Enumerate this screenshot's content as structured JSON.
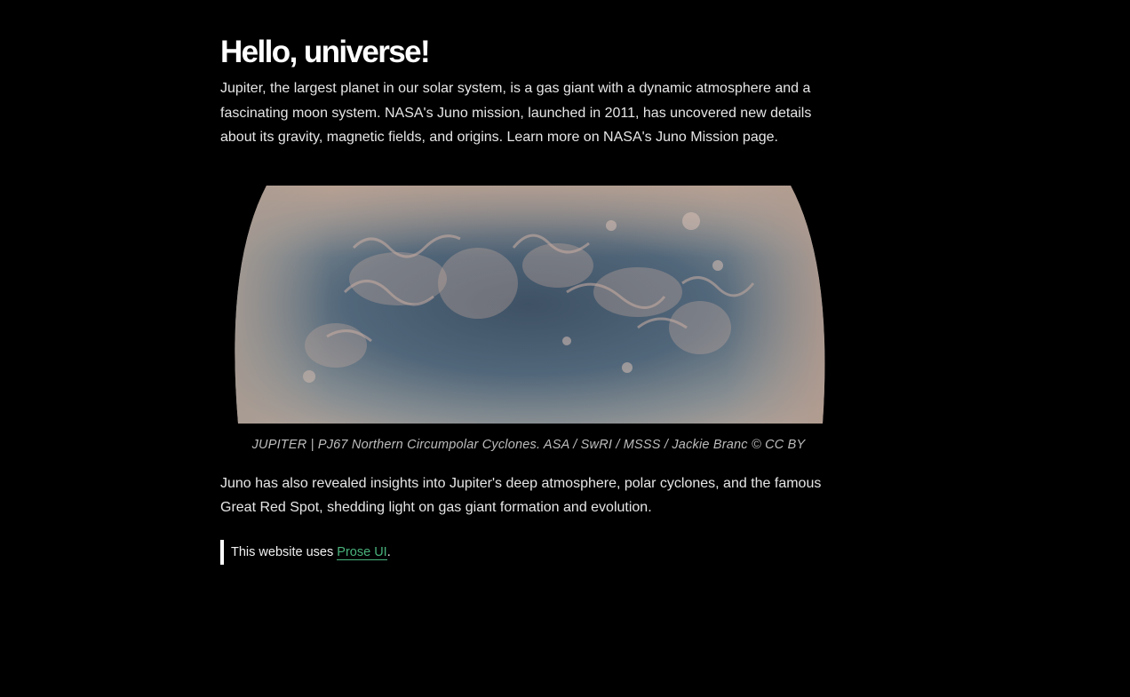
{
  "heading": "Hello, universe!",
  "intro": "Jupiter, the largest planet in our solar system, is a gas giant with a dynamic atmosphere and a fascinating moon system. NASA's Juno mission, launched in 2011, has uncovered new details about its gravity, magnetic fields, and origins. Learn more on NASA's Juno Mission page.",
  "figure": {
    "caption": "JUPITER | PJ67 Northern Circumpolar Cyclones. ASA / SwRI / MSSS / Jackie Branc © CC BY"
  },
  "outro": "Juno has also revealed insights into Jupiter's deep atmosphere, polar cyclones, and the famous Great Red Spot, shedding light on gas giant formation and evolution.",
  "note": {
    "prefix": "This website uses ",
    "link_label": "Prose UI",
    "suffix": "."
  },
  "colors": {
    "background": "#000000",
    "link": "#49b37c",
    "text": "#e6e6e6"
  }
}
